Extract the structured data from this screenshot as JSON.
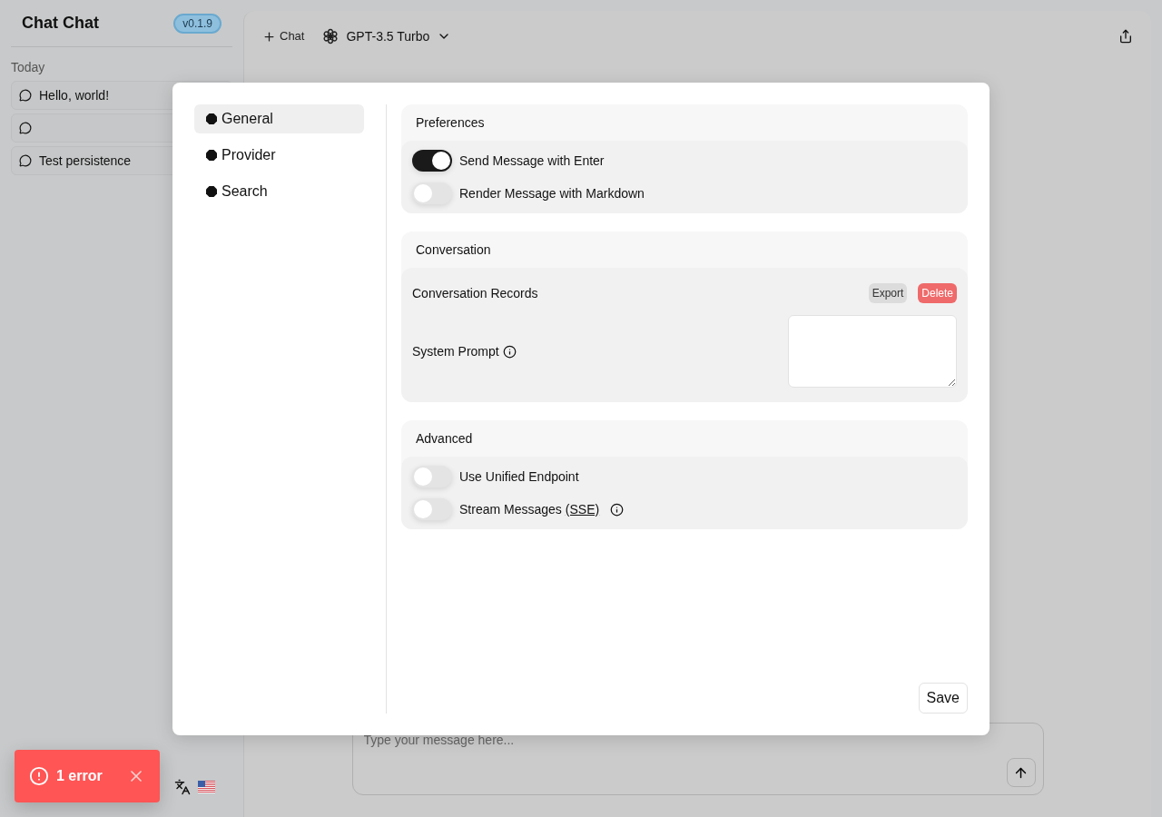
{
  "app": {
    "title": "Chat Chat",
    "version": "v0.1.9"
  },
  "sidebar": {
    "group_label": "Today",
    "chats": [
      {
        "kind": "titled",
        "title": "Hello, world!"
      },
      {
        "kind": "untitled"
      },
      {
        "kind": "titled",
        "title": "Test persistence"
      }
    ]
  },
  "toolbar": {
    "new_chat_label": "Chat",
    "model": "GPT-3.5 Turbo"
  },
  "composer": {
    "placeholder": "Type your message here..."
  },
  "toast": {
    "text": "1 error"
  },
  "settings": {
    "nav": [
      {
        "label": "General",
        "selected": true
      },
      {
        "label": "Provider",
        "selected": false
      },
      {
        "label": "Search",
        "selected": false
      }
    ],
    "sections": [
      {
        "title": "Preferences",
        "rows": [
          {
            "kind": "toggle",
            "label": "Send Message with Enter",
            "on": true
          },
          {
            "kind": "toggle",
            "label": "Render Message with Markdown",
            "on": false
          }
        ]
      },
      {
        "title": "Conversation",
        "rows": [
          {
            "kind": "actions",
            "label": "Conversation Records",
            "buttons": [
              {
                "label": "Export",
                "kind": "neutral"
              },
              {
                "label": "Delete",
                "kind": "danger"
              }
            ]
          },
          {
            "kind": "textarea",
            "label": "System Prompt",
            "info": true
          }
        ]
      },
      {
        "title": "Advanced",
        "rows": [
          {
            "kind": "toggle",
            "label": "Use Unified Endpoint",
            "on": false
          },
          {
            "kind": "toggle",
            "label": "Stream Messages",
            "abbr": "(SSE)",
            "on": false,
            "info": true
          }
        ]
      }
    ],
    "save_label": "Save"
  }
}
